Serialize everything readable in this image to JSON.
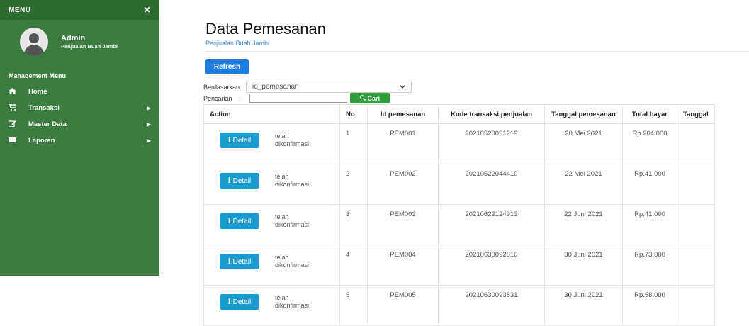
{
  "sidebar": {
    "header": "MENU",
    "close_icon": "✕",
    "user": {
      "name": "Admin",
      "subtitle": "Penjualan Buah Jambi"
    },
    "section": "Management Menu",
    "items": [
      {
        "label": "Home",
        "icon": "home-icon",
        "has_chevron": false
      },
      {
        "label": "Transaksi",
        "icon": "cart-icon",
        "has_chevron": true
      },
      {
        "label": "Master Data",
        "icon": "edit-icon",
        "has_chevron": true
      },
      {
        "label": "Laporan",
        "icon": "report-icon",
        "has_chevron": true
      }
    ]
  },
  "main": {
    "title": "Data Pemesanan",
    "subtitle": "Penjualan Buah Jambi",
    "refresh_label": "Refresh",
    "filter_label": "Berdasarkan :",
    "filter_value": "id_pemesanan",
    "search_label": "Pencarian",
    "search_colon": ":",
    "search_value": "",
    "search_button": "Cari"
  },
  "table": {
    "columns": [
      "Action",
      "No",
      "Id pemesanan",
      "Kode transaksi penjualan",
      "Tanggal pemesanan",
      "Total bayar",
      "Tanggal"
    ],
    "detail_label": "Detail",
    "rows": [
      {
        "no": "1",
        "id": "PEM001",
        "kode": "20210520091219",
        "tanggal": "20 Mei 2021",
        "total": "Rp.204.000",
        "status": "telah dikonfirmasi"
      },
      {
        "no": "2",
        "id": "PEM002",
        "kode": "20210522044410",
        "tanggal": "22 Mei 2021",
        "total": "Rp.41.000",
        "status": "telah dikonfirmasi"
      },
      {
        "no": "3",
        "id": "PEM003",
        "kode": "20210622124913",
        "tanggal": "22 Juni 2021",
        "total": "Rp.41.000",
        "status": "telah dikonfirmasi"
      },
      {
        "no": "4",
        "id": "PEM004",
        "kode": "20210630092810",
        "tanggal": "30 Juni 2021",
        "total": "Rp.73.000",
        "status": "telah dikonfirmasi"
      },
      {
        "no": "5",
        "id": "PEM005",
        "kode": "20210630093831",
        "tanggal": "30 Juni 2021",
        "total": "Rp.58.000",
        "status": "telah dikonfirmasi"
      }
    ]
  },
  "colors": {
    "sidebar": "#3c7c3f",
    "primary": "#1e7be0",
    "success": "#2e9e3a",
    "info": "#1a9bd0"
  }
}
